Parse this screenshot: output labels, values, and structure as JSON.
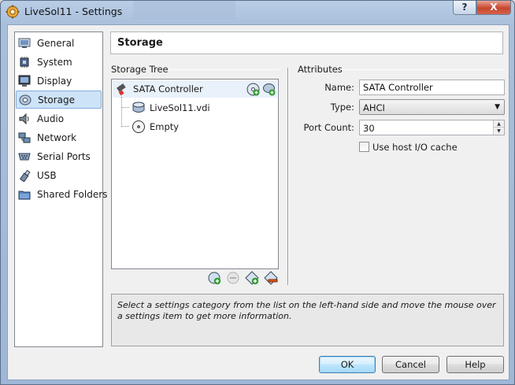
{
  "window": {
    "title": "LiveSol11 - Settings",
    "help_label": "?",
    "close_label": "X"
  },
  "sidebar": {
    "items": [
      {
        "label": "General",
        "icon": "general-icon"
      },
      {
        "label": "System",
        "icon": "system-chip-icon"
      },
      {
        "label": "Display",
        "icon": "display-monitor-icon"
      },
      {
        "label": "Storage",
        "icon": "storage-disk-icon",
        "selected": true
      },
      {
        "label": "Audio",
        "icon": "speaker-icon"
      },
      {
        "label": "Network",
        "icon": "network-icon"
      },
      {
        "label": "Serial Ports",
        "icon": "serial-port-icon"
      },
      {
        "label": "USB",
        "icon": "usb-icon"
      },
      {
        "label": "Shared Folders",
        "icon": "folder-icon"
      }
    ]
  },
  "page": {
    "title": "Storage"
  },
  "storage_tree": {
    "section_title": "Storage Tree",
    "controller": "SATA Controller",
    "children": [
      {
        "label": "LiveSol11.vdi",
        "icon": "hard-disk-icon"
      },
      {
        "label": "Empty",
        "icon": "optical-disc-icon"
      }
    ]
  },
  "attributes": {
    "section_title": "Attributes",
    "name_label": "Name:",
    "name_value": "SATA Controller",
    "type_label": "Type:",
    "type_value": "AHCI",
    "port_count_label": "Port Count:",
    "port_count_value": "30",
    "host_io_cache_label": "Use host I/O cache",
    "host_io_cache_checked": false
  },
  "info": {
    "text": "Select a settings category from the list on the left-hand side and move the mouse over a settings item to get more information."
  },
  "buttons": {
    "ok": "OK",
    "cancel": "Cancel",
    "help": "Help"
  }
}
